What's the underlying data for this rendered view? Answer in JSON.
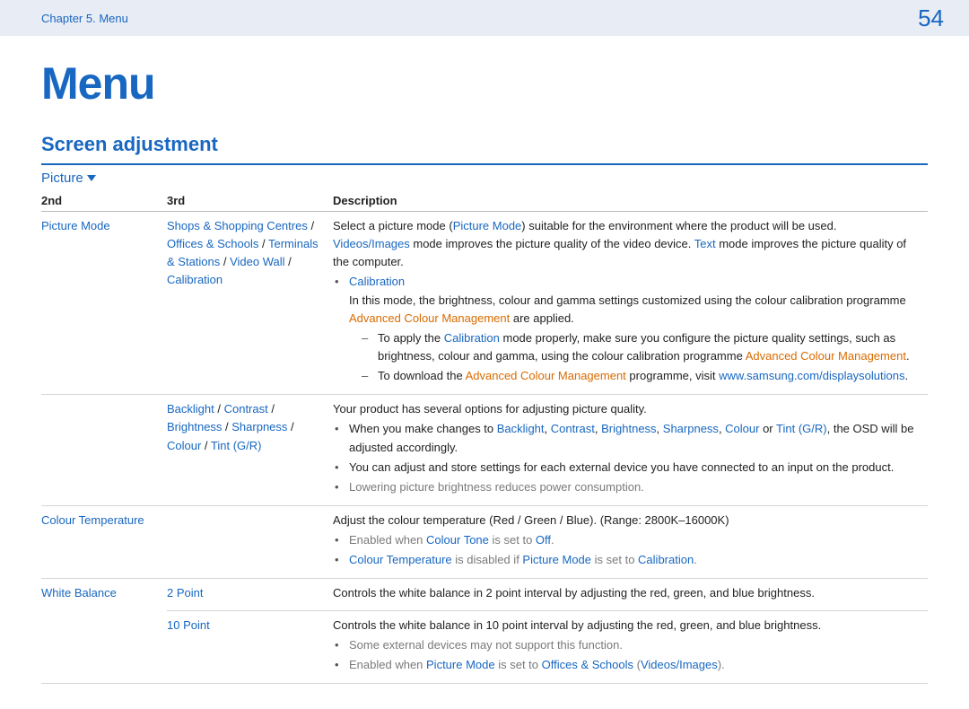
{
  "header": {
    "chapter": "Chapter 5. Menu",
    "page": "54"
  },
  "title": "Menu",
  "section": "Screen adjustment",
  "tab": "Picture",
  "columns": {
    "c1": "2nd",
    "c2": "3rd",
    "c3": "Description"
  },
  "r1": {
    "col1": "Picture Mode",
    "col2": {
      "a1": "Shops & Shopping Centres",
      "a2": "Offices & Schools",
      "a3": "Terminals & Stations",
      "a4": "Video Wall",
      "a5": "Calibration"
    },
    "d": {
      "p1a": "Select a picture mode (",
      "p1b": "Picture Mode",
      "p1c": ") suitable for the environment where the product will be used.",
      "p2a": "Videos/Images",
      "p2b": " mode improves the picture quality of the video device. ",
      "p2c": "Text",
      "p2d": " mode improves the picture quality of the computer.",
      "cal_h": "Calibration",
      "cal_p1a": "In this mode, the brightness, colour and gamma settings customized using the colour calibration programme ",
      "cal_p1b": "Advanced Colour Management",
      "cal_p1c": " are applied.",
      "d1a": "To apply the ",
      "d1b": "Calibration",
      "d1c": " mode properly, make sure you configure the picture quality settings, such as brightness, colour and gamma, using the colour calibration programme ",
      "d1d": "Advanced Colour Management",
      "d1e": ".",
      "d2a": "To download the ",
      "d2b": "Advanced Colour Management",
      "d2c": " programme, visit ",
      "d2d": "www.samsung.com/displaysolutions",
      "d2e": "."
    }
  },
  "r2": {
    "col2": {
      "a1": "Backlight",
      "a2": "Contrast",
      "a3": "Brightness",
      "a4": "Sharpness",
      "a5": "Colour",
      "a6": "Tint (G/R)"
    },
    "d": {
      "p1": "Your product has several options for adjusting picture quality.",
      "b1a": "When you make changes to ",
      "b1b": "Backlight",
      "b1c": ", ",
      "b1d": "Contrast",
      "b1e": ", ",
      "b1f": "Brightness",
      "b1g": ", ",
      "b1h": "Sharpness",
      "b1i": ", ",
      "b1j": "Colour",
      "b1k": " or ",
      "b1l": "Tint (G/R)",
      "b1m": ", the OSD will be adjusted accordingly.",
      "b2": "You can adjust and store settings for each external device you have connected to an input on the product.",
      "b3": "Lowering picture brightness reduces power consumption."
    }
  },
  "r3": {
    "col1": "Colour Temperature",
    "d": {
      "p1": "Adjust the colour temperature (Red / Green / Blue). (Range: 2800K–16000K)",
      "b1a": "Enabled when ",
      "b1b": "Colour Tone",
      "b1c": " is set to ",
      "b1d": "Off",
      "b1e": ".",
      "b2a": "Colour Temperature",
      "b2b": " is disabled if ",
      "b2c": "Picture Mode",
      "b2d": " is set to ",
      "b2e": "Calibration",
      "b2f": "."
    }
  },
  "r4": {
    "col1": "White Balance",
    "col2a": "2 Point",
    "d": {
      "p1": "Controls the white balance in 2 point interval by adjusting the red, green, and blue brightness."
    }
  },
  "r5": {
    "col2a": "10 Point",
    "d": {
      "p1": "Controls the white balance in 10 point interval by adjusting the red, green, and blue brightness.",
      "b1": "Some external devices may not support this function.",
      "b2a": "Enabled when ",
      "b2b": "Picture Mode",
      "b2c": " is set to ",
      "b2d": "Offices & Schools",
      "b2e": " (",
      "b2f": "Videos/Images",
      "b2g": ")."
    }
  }
}
